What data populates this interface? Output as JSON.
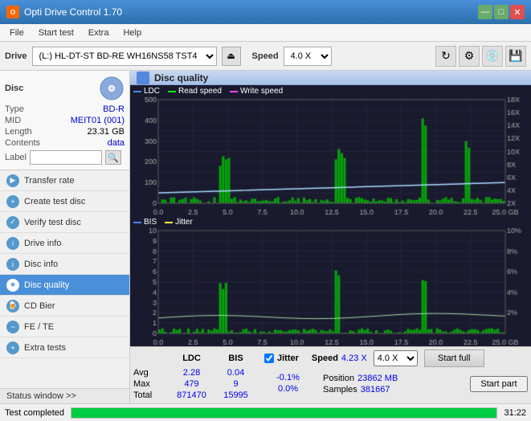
{
  "titleBar": {
    "title": "Opti Drive Control 1.70",
    "minBtn": "—",
    "maxBtn": "□",
    "closeBtn": "✕"
  },
  "menuBar": {
    "items": [
      "File",
      "Start test",
      "Extra",
      "Help"
    ]
  },
  "toolbar": {
    "driveLabel": "Drive",
    "driveValue": "(L:)  HL-DT-ST BD-RE  WH16NS58 TST4",
    "speedLabel": "Speed",
    "speedValue": "4.0 X"
  },
  "sidebar": {
    "disc": {
      "title": "Disc",
      "typeLabel": "Type",
      "typeValue": "BD-R",
      "midLabel": "MID",
      "midValue": "MEIT01 (001)",
      "lengthLabel": "Length",
      "lengthValue": "23.31 GB",
      "contentsLabel": "Contents",
      "contentsValue": "data",
      "labelLabel": "Label"
    },
    "navItems": [
      {
        "id": "transfer-rate",
        "label": "Transfer rate",
        "active": false
      },
      {
        "id": "create-test-disc",
        "label": "Create test disc",
        "active": false
      },
      {
        "id": "verify-test-disc",
        "label": "Verify test disc",
        "active": false
      },
      {
        "id": "drive-info",
        "label": "Drive info",
        "active": false
      },
      {
        "id": "disc-info",
        "label": "Disc info",
        "active": false
      },
      {
        "id": "disc-quality",
        "label": "Disc quality",
        "active": true
      },
      {
        "id": "cd-bier",
        "label": "CD Bier",
        "active": false
      },
      {
        "id": "fe-te",
        "label": "FE / TE",
        "active": false
      },
      {
        "id": "extra-tests",
        "label": "Extra tests",
        "active": false
      }
    ],
    "statusWindow": "Status window >>"
  },
  "discQuality": {
    "title": "Disc quality",
    "chart1": {
      "legend": [
        "LDC",
        "Read speed",
        "Write speed"
      ],
      "yLabels": [
        "18X",
        "16X",
        "14X",
        "12X",
        "10X",
        "8X",
        "6X",
        "4X",
        "2X"
      ],
      "yLabelsLeft": [
        "500",
        "400",
        "300",
        "200",
        "100"
      ],
      "xLabels": [
        "0.0",
        "2.5",
        "5.0",
        "7.5",
        "10.0",
        "12.5",
        "15.0",
        "17.5",
        "20.0",
        "22.5",
        "25.0 GB"
      ]
    },
    "chart2": {
      "legend": [
        "BIS",
        "Jitter"
      ],
      "yLabelsRight": [
        "10%",
        "8%",
        "6%",
        "4%",
        "2%"
      ],
      "yLabelsLeft": [
        "10",
        "9",
        "8",
        "7",
        "6",
        "5",
        "4",
        "3",
        "2",
        "1"
      ],
      "xLabels": [
        "0.0",
        "2.5",
        "5.0",
        "7.5",
        "10.0",
        "12.5",
        "15.0",
        "17.5",
        "20.0",
        "22.5",
        "25.0 GB"
      ]
    }
  },
  "statsTable": {
    "headers": [
      "",
      "LDC",
      "BIS",
      "",
      "Jitter",
      "Speed",
      ""
    ],
    "rows": [
      {
        "label": "Avg",
        "ldc": "2.28",
        "bis": "0.04",
        "jitter": "-0.1%",
        "speed": "4.23 X"
      },
      {
        "label": "Max",
        "ldc": "479",
        "bis": "9",
        "jitter": "0.0%"
      },
      {
        "label": "Total",
        "ldc": "871470",
        "bis": "15995"
      }
    ],
    "position": {
      "label": "Position",
      "value": "23862 MB"
    },
    "samples": {
      "label": "Samples",
      "value": "381667"
    },
    "speedSelect": "4.0 X",
    "startFullBtn": "Start full",
    "startPartBtn": "Start part"
  },
  "statusBar": {
    "text": "Test completed",
    "progressPct": 100,
    "time": "31:22"
  }
}
